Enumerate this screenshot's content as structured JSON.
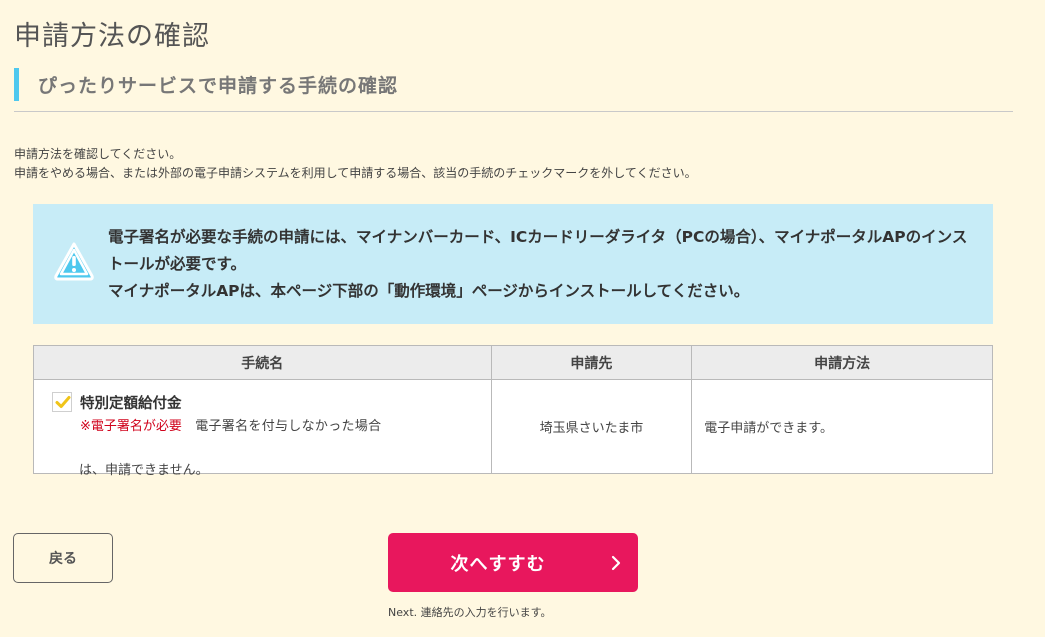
{
  "page": {
    "title": "申請方法の確認",
    "section_heading": "ぴったりサービスで申請する手続の確認"
  },
  "instructions": {
    "line1": "申請方法を確認してください。",
    "line2": "申請をやめる場合、または外部の電子申請システムを利用して申請する場合、該当の手続のチェックマークを外してください。"
  },
  "notice": {
    "icon": "warning-icon",
    "line1": "電子署名が必要な手続の申請には、マイナンバーカード、ICカードリーダライタ（PCの場合）、マイナポータルAPのインストールが必要です。",
    "line2": "マイナポータルAPは、本ページ下部の「動作環境」ページからインストールしてください。"
  },
  "table": {
    "headers": {
      "name": "手続名",
      "destination": "申請先",
      "method": "申請方法"
    },
    "rows": [
      {
        "checked": true,
        "name": "特別定額給付金",
        "note_required": "※電子署名が必要",
        "note_rest": "　電子署名を付与しなかった場合",
        "note_line2": "は、申請できません。",
        "destination": "埼玉県さいたま市",
        "method": "電子申請ができます。"
      }
    ]
  },
  "buttons": {
    "back": "戻る",
    "next": "次へすすむ",
    "next_caption": "Next. 連絡先の入力を行います。"
  },
  "colors": {
    "background": "#fff8e1",
    "accent_bar": "#4ec8ee",
    "notice_bg": "#c7ecf7",
    "primary_button": "#e8175d",
    "required_text": "#d0021b",
    "check_mark": "#f0c419"
  }
}
